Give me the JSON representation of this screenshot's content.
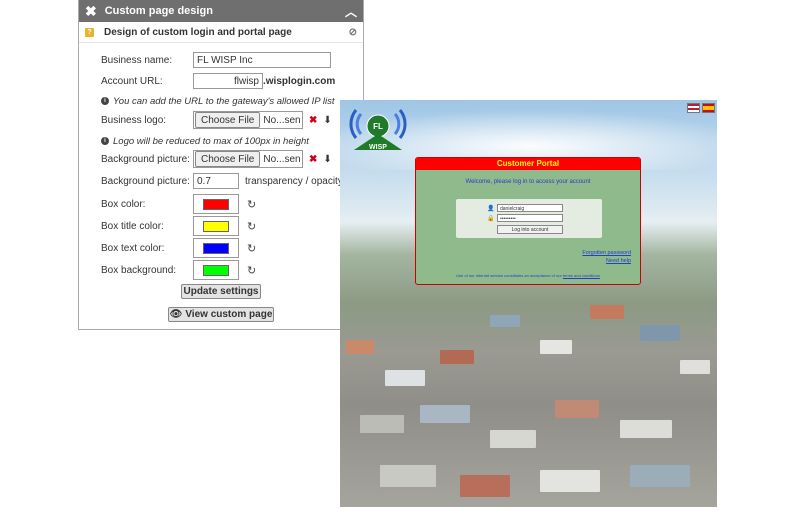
{
  "panel": {
    "title": "Custom page design",
    "collapse_icon": "chevron-up-icon",
    "close_icon": "close-icon",
    "subheading": "Design of custom login and portal page",
    "hide_icon": "eye-slash-icon"
  },
  "form": {
    "business_name_label": "Business name:",
    "business_name_value": "FL WISP Inc",
    "account_url_label": "Account URL:",
    "account_url_value": "flwisp",
    "account_url_suffix": ".wisplogin.com",
    "url_note": "You can add the URL to the gateway's allowed IP list",
    "business_logo_label": "Business logo:",
    "choose_file": "Choose File",
    "no_file": "No...sen",
    "logo_note": "Logo will be reduced to max of 100px in height",
    "bg_picture_label": "Background picture:",
    "bg_opacity_label": "Background picture:",
    "bg_opacity_value": "0.7",
    "bg_opacity_suffix": "transparency / opacity",
    "box_color_label": "Box color:",
    "box_title_color_label": "Box title color:",
    "box_text_color_label": "Box text color:",
    "box_background_label": "Box background:",
    "update_button": "Update settings",
    "view_button": "View custom page"
  },
  "colors": {
    "box_color": "#ff0000",
    "box_title_color": "#ffff00",
    "box_text_color": "#0000ff",
    "box_background": "#00ff00"
  },
  "portal": {
    "logo_text_top": "FL",
    "logo_text_bottom": "WISP",
    "title": "Customer Portal",
    "welcome": "Welcome, please log in to access your account",
    "username": "danielcraig",
    "password": "•••••••••",
    "login_button": "Log into account",
    "forgotten_password": "Forgotten password",
    "need_help": "Need help",
    "terms_prefix": "Use of our Internet service constitutes an acceptance of our",
    "terms_link": "terms and conditions"
  }
}
